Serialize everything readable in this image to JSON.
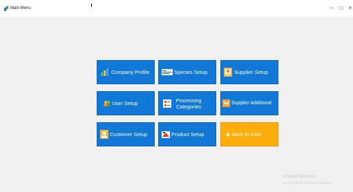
{
  "window": {
    "title": "Main Menu",
    "controls": {
      "minimize": "–",
      "maximize": "□",
      "close": "×"
    }
  },
  "menu": {
    "company_profile": "Company Profile",
    "species_setup": "Species Setup",
    "supplier_setup": "Supplier Setup",
    "user_setup": "User Setup",
    "processing_categories": "Processing Categories",
    "supplier_additional": "Supplier Additional",
    "customer_setup": "Customer Setup",
    "product_setup": "Product Setup",
    "back_to_main": "back to main"
  },
  "watermark": {
    "line1": "Activate Windows",
    "line2": "Go to Settings to activate Windows."
  },
  "colors": {
    "tile_blue": "#1278d8",
    "tile_orange": "#ffad0d",
    "background": "#efefef"
  },
  "icons": {
    "company_profile": "company-chart-icon",
    "species_setup": "species-list-icon",
    "supplier_setup": "supplier-form-icon",
    "user_setup": "users-icon",
    "processing_categories": "categories-icon",
    "supplier_additional": "supplier-add-icon",
    "customer_setup": "customer-icon",
    "product_setup": "product-icon",
    "back_to_main": "back-dot-icon"
  }
}
